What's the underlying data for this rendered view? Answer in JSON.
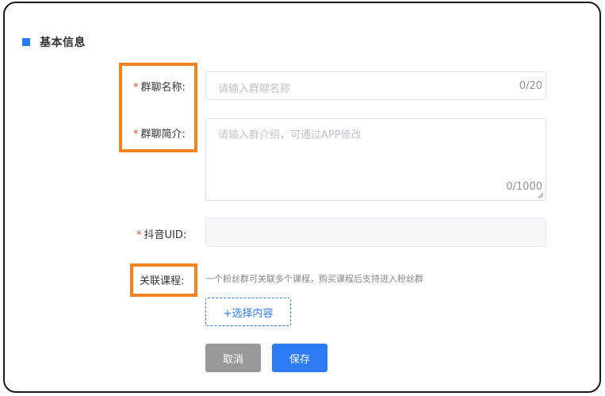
{
  "section": {
    "title": "基本信息",
    "accent_color": "#2d7cf6"
  },
  "form": {
    "group_name": {
      "required_mark": "*",
      "label": "群聊名称:",
      "placeholder": "请输入群聊名称",
      "value": "",
      "counter": "0/20"
    },
    "group_intro": {
      "required_mark": "*",
      "label": "群聊简介:",
      "placeholder": "请输入群介绍，可通过APP修改",
      "value": "",
      "counter": "0/1000"
    },
    "douyin_uid": {
      "required_mark": "*",
      "label": "抖音UID:",
      "value": ""
    },
    "related_courses": {
      "label": "关联课程:",
      "hint": "一个粉丝群可关联多个课程，购买课程后支持进入粉丝群",
      "select_button": "+选择内容"
    }
  },
  "actions": {
    "cancel": "取消",
    "save": "保存"
  },
  "highlight_color": "#f28322"
}
